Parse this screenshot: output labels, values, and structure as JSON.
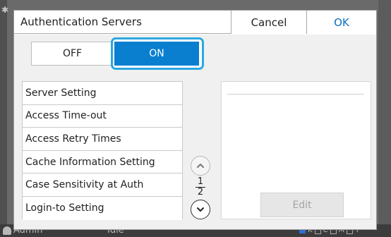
{
  "dialog": {
    "title": "Authentication Servers",
    "cancel_label": "Cancel",
    "ok_label": "OK"
  },
  "toggle": {
    "off_label": "OFF",
    "on_label": "ON",
    "selected": "ON"
  },
  "settings_list": {
    "items": [
      {
        "label": "Server Setting"
      },
      {
        "label": "Access Time-out"
      },
      {
        "label": "Access Retry Times"
      },
      {
        "label": "Cache Information Setting"
      },
      {
        "label": "Case Sensitivity at Auth"
      },
      {
        "label": "Login-to Setting"
      }
    ]
  },
  "pager": {
    "current_page": "1",
    "total_pages": "2",
    "up_icon": "chevron-up-icon",
    "down_icon": "chevron-down-icon"
  },
  "detail_panel": {
    "edit_label": "Edit"
  },
  "background_status": {
    "user_label": "Admin",
    "status_label": "Idle",
    "ink_labels": [
      "K",
      "C",
      "M",
      "Y"
    ],
    "ink_colors": [
      "#222222",
      "#00aeef",
      "#ec008c",
      "#fff200"
    ]
  },
  "colors": {
    "accent": "#0a7fd0",
    "focus_outline": "#2aa8e0",
    "ok_text": "#0a6fc2"
  }
}
